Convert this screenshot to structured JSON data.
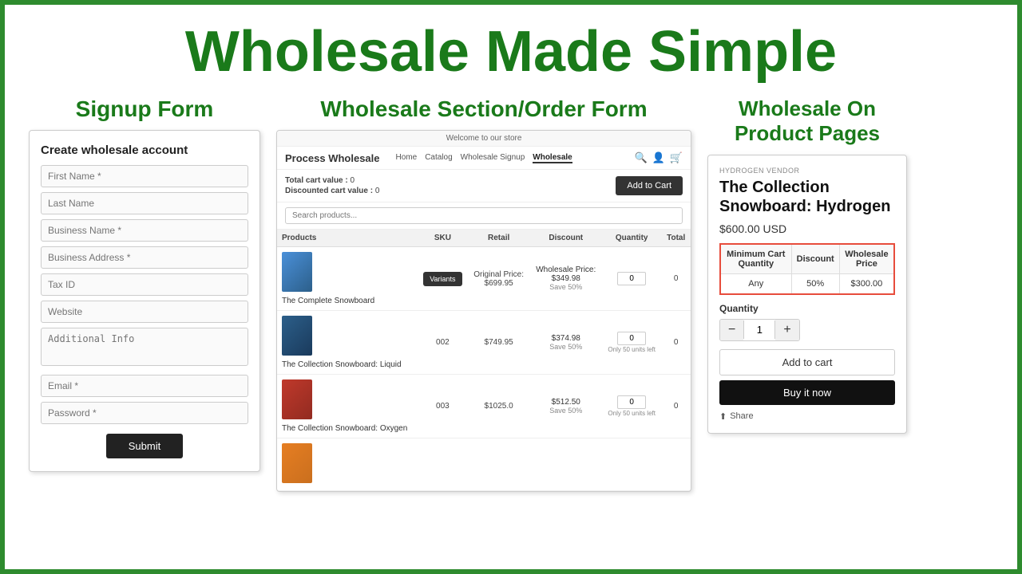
{
  "border_color": "#2e8b2e",
  "headline": "Wholesale Made Simple",
  "left": {
    "section_title": "Signup Form",
    "box_title": "Create wholesale account",
    "fields": [
      {
        "placeholder": "First Name *",
        "type": "text"
      },
      {
        "placeholder": "Last Name",
        "type": "text"
      },
      {
        "placeholder": "Business Name *",
        "type": "text"
      },
      {
        "placeholder": "Business Address *",
        "type": "text"
      },
      {
        "placeholder": "Tax ID",
        "type": "text"
      },
      {
        "placeholder": "Website",
        "type": "text"
      },
      {
        "placeholder": "Additional Info",
        "type": "textarea"
      },
      {
        "placeholder": "Email *",
        "type": "email"
      },
      {
        "placeholder": "Password *",
        "type": "password"
      }
    ],
    "submit_label": "Submit"
  },
  "middle": {
    "section_title": "Wholesale Section/Order Form",
    "topbar": "Welcome to our store",
    "nav_brand": "Process Wholesale",
    "nav_links": [
      "Home",
      "Catalog",
      "Wholesale Signup",
      "Wholesale"
    ],
    "cart_value_label": "Total cart value :",
    "cart_value": "0",
    "discounted_label": "Discounted cart value :",
    "discounted_value": "0",
    "add_to_cart_label": "Add to Cart",
    "search_placeholder": "Search products...",
    "table": {
      "headers": [
        "Products",
        "SKU",
        "Retail",
        "Discount",
        "Quantity",
        "Total"
      ],
      "rows": [
        {
          "name": "The Complete Snowboard",
          "sku": "",
          "has_variants": true,
          "variants_label": "Variants",
          "retail": "Original Price:\n$699.95",
          "discount": "Wholesale Price:\n$349.98\nSave 50%",
          "quantity": "0",
          "total": "0",
          "thumb_class": "default"
        },
        {
          "name": "The Collection Snowboard: Liquid",
          "sku": "002",
          "has_variants": false,
          "retail": "$749.95",
          "discount": "$374.98\nSave 50%",
          "quantity": "0",
          "units_left": "Only 50 units left",
          "total": "0",
          "thumb_class": "liquid"
        },
        {
          "name": "The Collection Snowboard: Oxygen",
          "sku": "003",
          "has_variants": false,
          "retail": "$1025.0",
          "discount": "$512.50\nSave 50%",
          "quantity": "0",
          "units_left": "Only 50 units left",
          "total": "0",
          "thumb_class": "oxygen"
        },
        {
          "name": "",
          "sku": "",
          "has_variants": false,
          "retail": "",
          "discount": "",
          "quantity": "",
          "total": "",
          "thumb_class": "bottom"
        }
      ]
    }
  },
  "right": {
    "section_title": "Wholesale On\nProduct Pages",
    "vendor": "HYDROGEN VENDOR",
    "product_title": "The Collection Snowboard: Hydrogen",
    "price": "$600.00 USD",
    "wholesale_table": {
      "headers": [
        "Minimum Cart\nQuantity",
        "Discount",
        "Wholesale\nPrice"
      ],
      "rows": [
        {
          "min_qty": "Any",
          "discount": "50%",
          "price": "$300.00"
        }
      ]
    },
    "quantity_label": "Quantity",
    "qty_value": "1",
    "add_to_cart_label": "Add to cart",
    "buy_now_label": "Buy it now",
    "share_label": "Share"
  }
}
